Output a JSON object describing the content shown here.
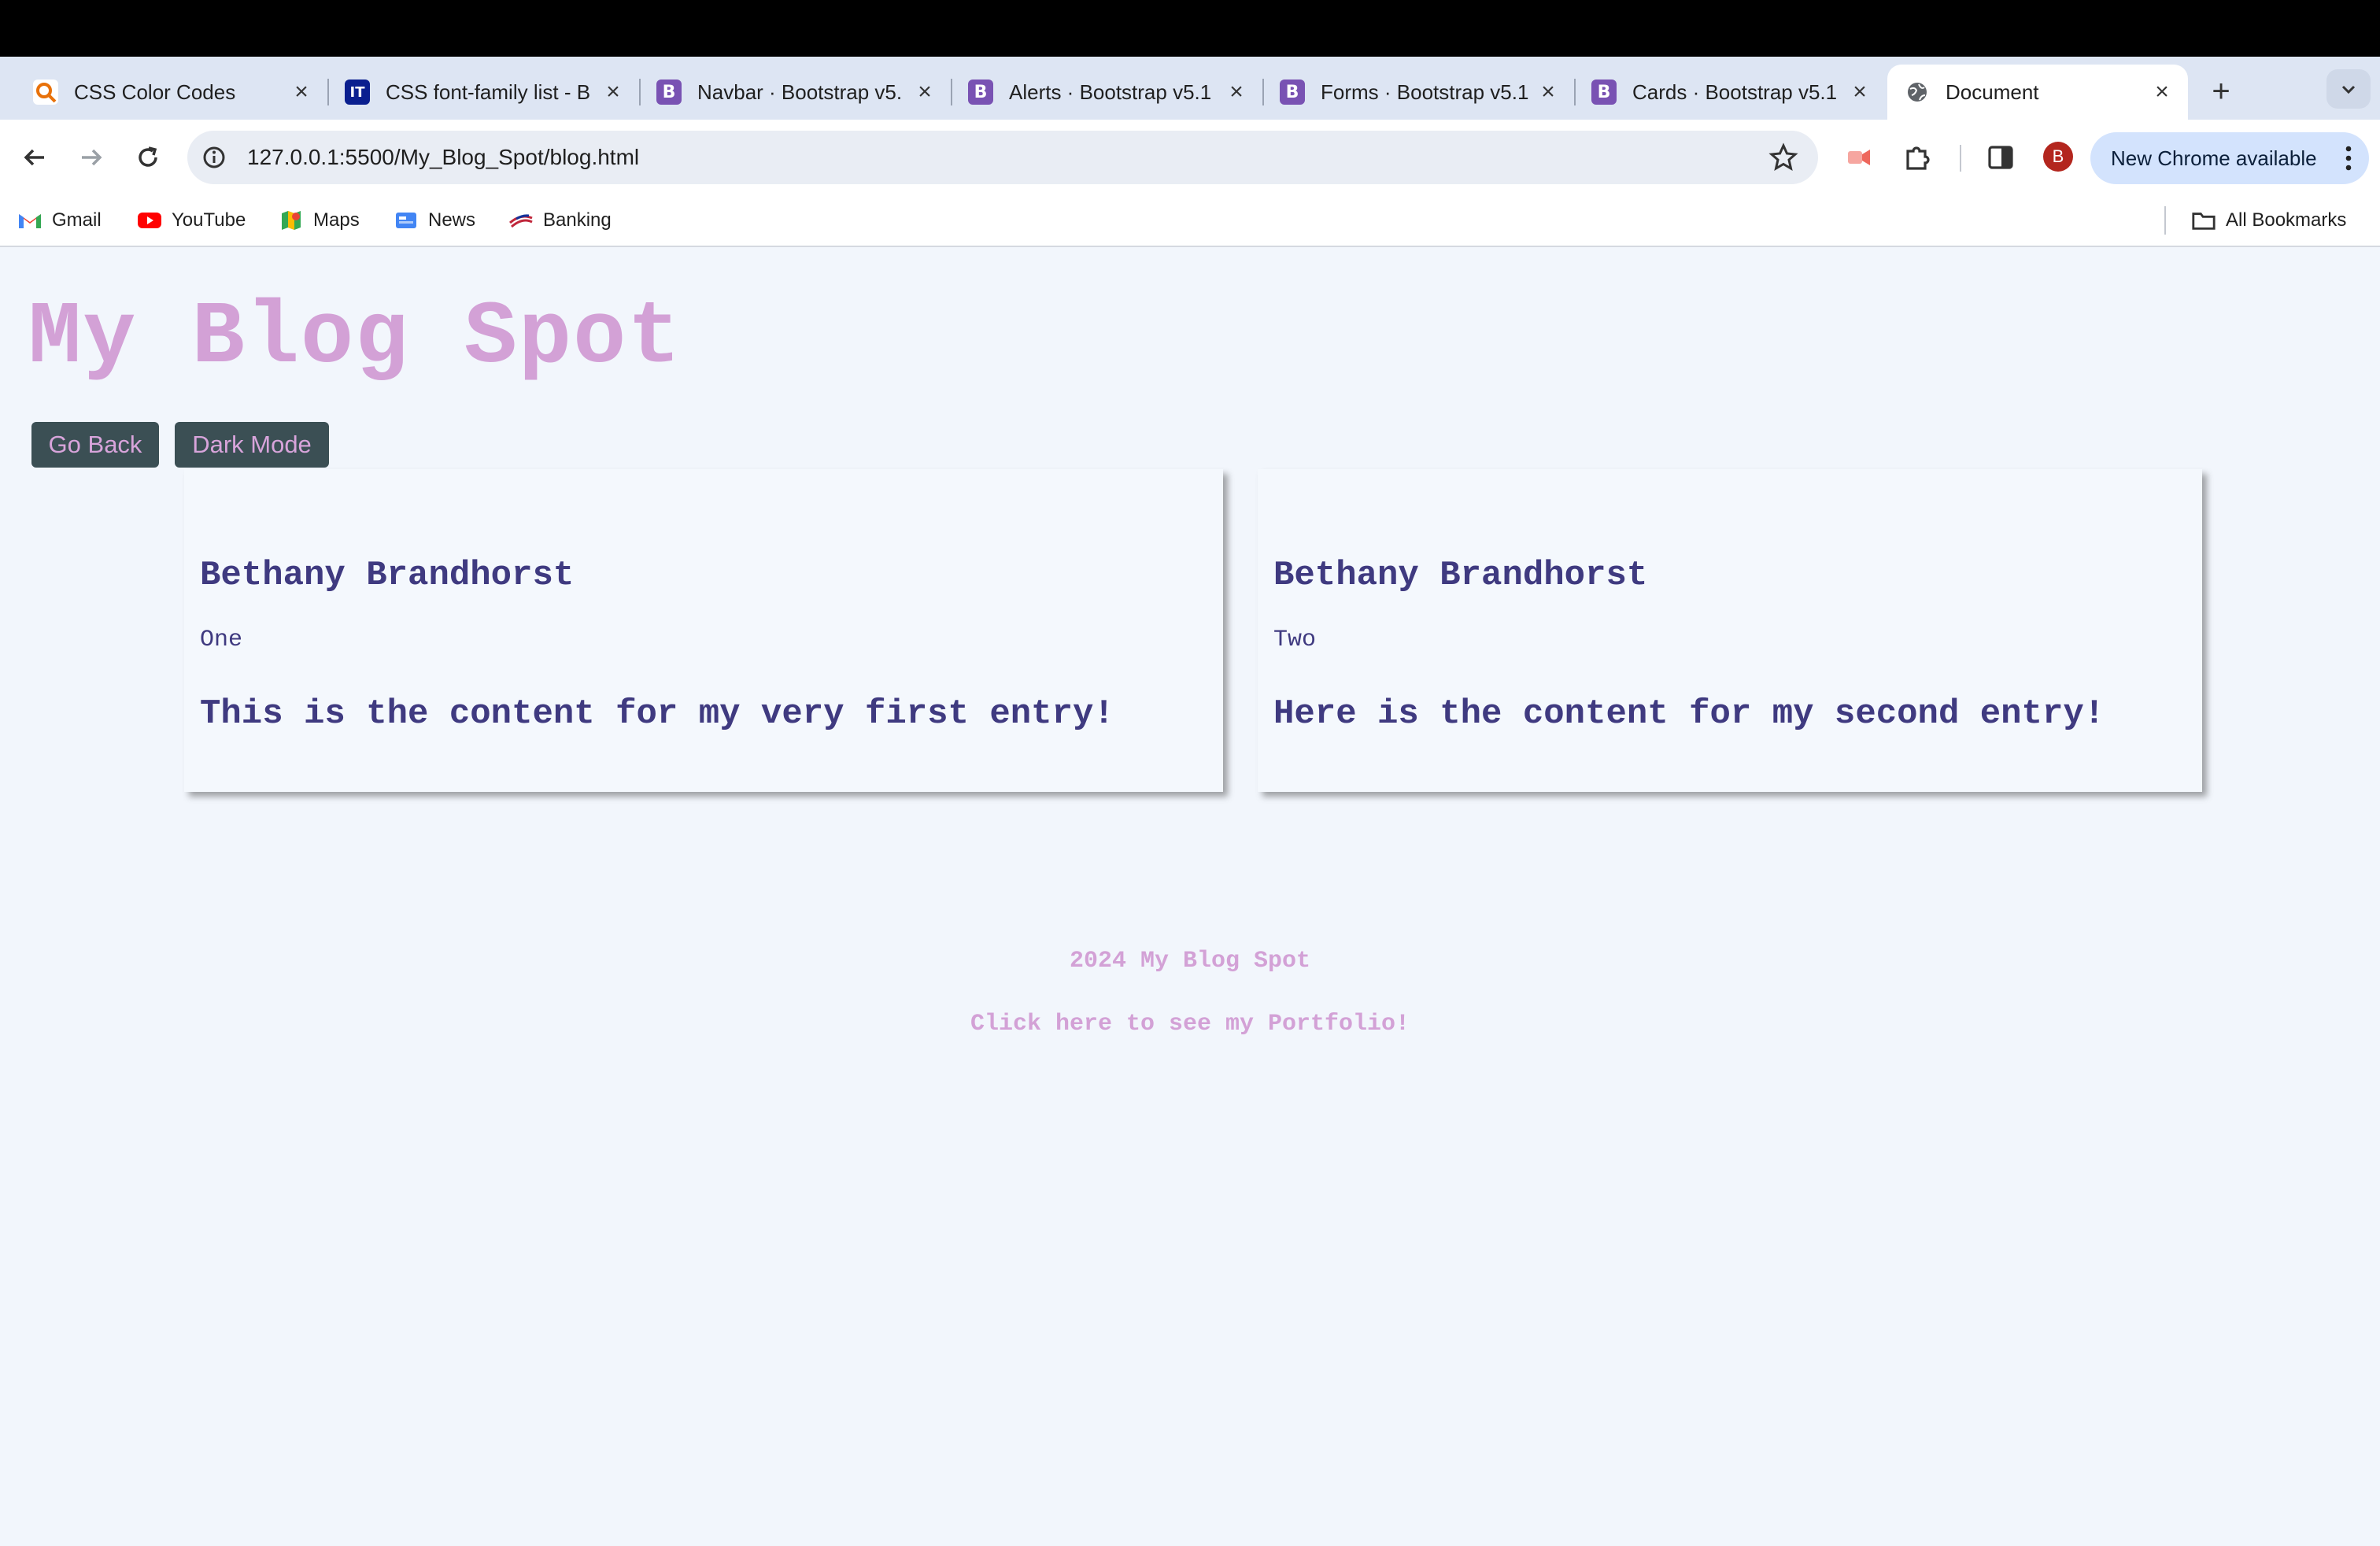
{
  "browser": {
    "tabs": [
      {
        "title": "CSS Color Codes",
        "favicon": "search-magnifier-icon",
        "favicon_color": "#e8710a",
        "active": false
      },
      {
        "title": "CSS font-family list - B",
        "favicon": "it-logo-icon",
        "favicon_color": "#0a1f8f",
        "active": false
      },
      {
        "title": "Navbar · Bootstrap v5.",
        "favicon": "bootstrap-icon",
        "favicon_color": "#7952b3",
        "active": false
      },
      {
        "title": "Alerts · Bootstrap v5.1",
        "favicon": "bootstrap-icon",
        "favicon_color": "#7952b3",
        "active": false
      },
      {
        "title": "Forms · Bootstrap v5.1",
        "favicon": "bootstrap-icon",
        "favicon_color": "#7952b3",
        "active": false
      },
      {
        "title": "Cards · Bootstrap v5.1",
        "favicon": "bootstrap-icon",
        "favicon_color": "#7952b3",
        "active": false
      },
      {
        "title": "Document",
        "favicon": "globe-icon",
        "favicon_color": "#5f6368",
        "active": true
      }
    ],
    "favicon_letters": {
      "bootstrap": "B",
      "it": "IT"
    },
    "new_tab": "+",
    "url": "127.0.0.1:5500/My_Blog_Spot/blog.html",
    "profile_initial": "B",
    "update_label": "New Chrome available",
    "bookmarks": [
      {
        "label": "Gmail",
        "icon": "gmail-icon"
      },
      {
        "label": "YouTube",
        "icon": "youtube-icon"
      },
      {
        "label": "Maps",
        "icon": "maps-icon"
      },
      {
        "label": "News",
        "icon": "news-icon"
      },
      {
        "label": "Banking",
        "icon": "banking-icon"
      }
    ],
    "all_bookmarks": "All Bookmarks"
  },
  "site": {
    "title": "My Blog Spot",
    "buttons": {
      "back": "Go Back",
      "dark": "Dark Mode"
    },
    "colors": {
      "accent": "#d3a1d6",
      "text": "#3f3a80",
      "button_bg": "#3b4f54",
      "page_bg": "#f2f6fc"
    },
    "posts": [
      {
        "author": "Bethany Brandhorst",
        "title": "One",
        "content": "This is the content for my very first entry!"
      },
      {
        "author": "Bethany Brandhorst",
        "title": "Two",
        "content": "Here is the content for my second entry!"
      }
    ],
    "footer": {
      "copyright": "2024 My Blog Spot",
      "portfolio_link": "Click here to see my Portfolio!"
    }
  }
}
